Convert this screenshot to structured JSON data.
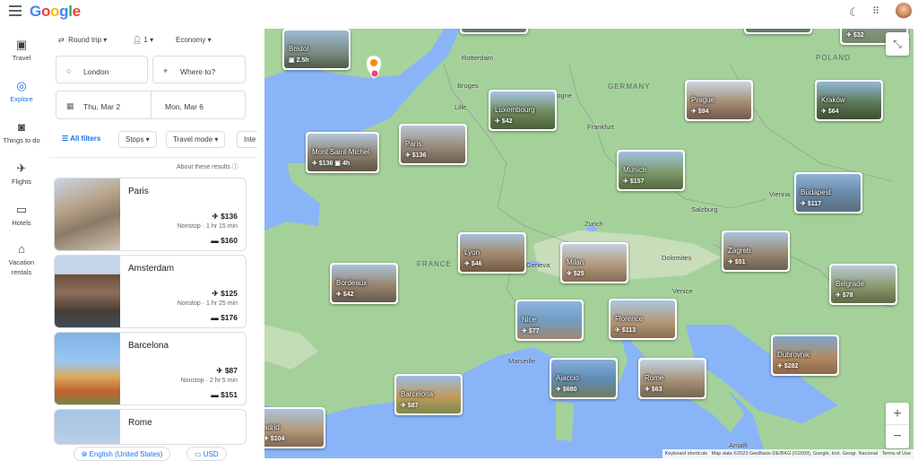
{
  "header": {
    "logo": "Google",
    "logo_colors": [
      "#4285f4",
      "#ea4335",
      "#fbbc05",
      "#4285f4",
      "#34a853",
      "#ea4335"
    ]
  },
  "rail": [
    {
      "label": "Travel",
      "icon": "suitcase-icon",
      "glyph": "🧳"
    },
    {
      "label": "Explore",
      "icon": "explore-globe-icon",
      "glyph": "🌐"
    },
    {
      "label": "Things to do",
      "icon": "camera-icon",
      "glyph": "📷"
    },
    {
      "label": "Flights",
      "icon": "plane-icon",
      "glyph": "✈"
    },
    {
      "label": "Hotels",
      "icon": "bed-icon",
      "glyph": "🛏"
    },
    {
      "label": "Vacation rentals",
      "icon": "house-icon",
      "glyph": "⌂"
    }
  ],
  "search": {
    "trip_type": "Round trip",
    "passengers": "1",
    "cabin": "Economy",
    "origin": "London",
    "destination_placeholder": "Where to?",
    "depart": "Thu, Mar 2",
    "return": "Mon, Mar 6"
  },
  "filters": {
    "all": "All filters",
    "stops": "Stops",
    "travel_mode": "Travel mode",
    "interests": "Inte"
  },
  "about_results": "About these results",
  "results": [
    {
      "name": "Paris",
      "flight_price": "$136",
      "flight_detail": "Nonstop · 1 hr 15 min",
      "hotel_price": "$160"
    },
    {
      "name": "Amsterdam",
      "flight_price": "$125",
      "flight_detail": "Nonstop · 1 hr 25 min",
      "hotel_price": "$176"
    },
    {
      "name": "Barcelona",
      "flight_price": "$87",
      "flight_detail": "Nonstop · 2 hr 5 min",
      "hotel_price": "$151"
    },
    {
      "name": "Rome"
    }
  ],
  "footer": {
    "language": "English (United States)",
    "currency": "USD"
  },
  "map": {
    "countries": [
      "GERMANY",
      "POLAND",
      "FRANCE"
    ],
    "cities": [
      "Rotterdam",
      "Bruges",
      "Lille",
      "Cologne",
      "Frankfurt",
      "Zurich",
      "Geneva",
      "Salzburg",
      "Vienna",
      "Dolomites",
      "Venice",
      "Marseille",
      "Amalfi"
    ],
    "destinations": [
      {
        "name": "Bristol",
        "price": "2.5h"
      },
      {
        "name": "Luxembourg",
        "price": "$42"
      },
      {
        "name": "Prague",
        "price": "$94"
      },
      {
        "name": "Kraków",
        "price": "$64"
      },
      {
        "name": "Paris",
        "price": "$136"
      },
      {
        "name": "Mont Saint-Michel",
        "price": "$136",
        "extra": "4h"
      },
      {
        "name": "Munich",
        "price": "$157"
      },
      {
        "name": "Budapest",
        "price": "$117"
      },
      {
        "name": "Lyon",
        "price": "$46"
      },
      {
        "name": "Milan",
        "price": "$25"
      },
      {
        "name": "Zagreb",
        "price": "$51"
      },
      {
        "name": "Bordeaux",
        "price": "$42"
      },
      {
        "name": "Belgrade",
        "price": "$78"
      },
      {
        "name": "Nice",
        "price": "$77"
      },
      {
        "name": "Florence",
        "price": "$113"
      },
      {
        "name": "Dubrovnik",
        "price": "$282"
      },
      {
        "name": "Ajaccio",
        "price": "$680"
      },
      {
        "name": "Rome",
        "price": "$63"
      },
      {
        "name": "Barcelona",
        "price": "$87"
      },
      {
        "name": "adrid",
        "price": "$104"
      },
      {
        "name": "",
        "price": "$32"
      }
    ],
    "attribution": {
      "shortcuts": "Keyboard shortcuts",
      "data": "Map data ©2023 GeoBasis-DE/BKG (©2009), Google, Inst. Geogr. Nacional",
      "terms": "Terms of Use"
    },
    "zoom_in": "+",
    "zoom_out": "−"
  }
}
